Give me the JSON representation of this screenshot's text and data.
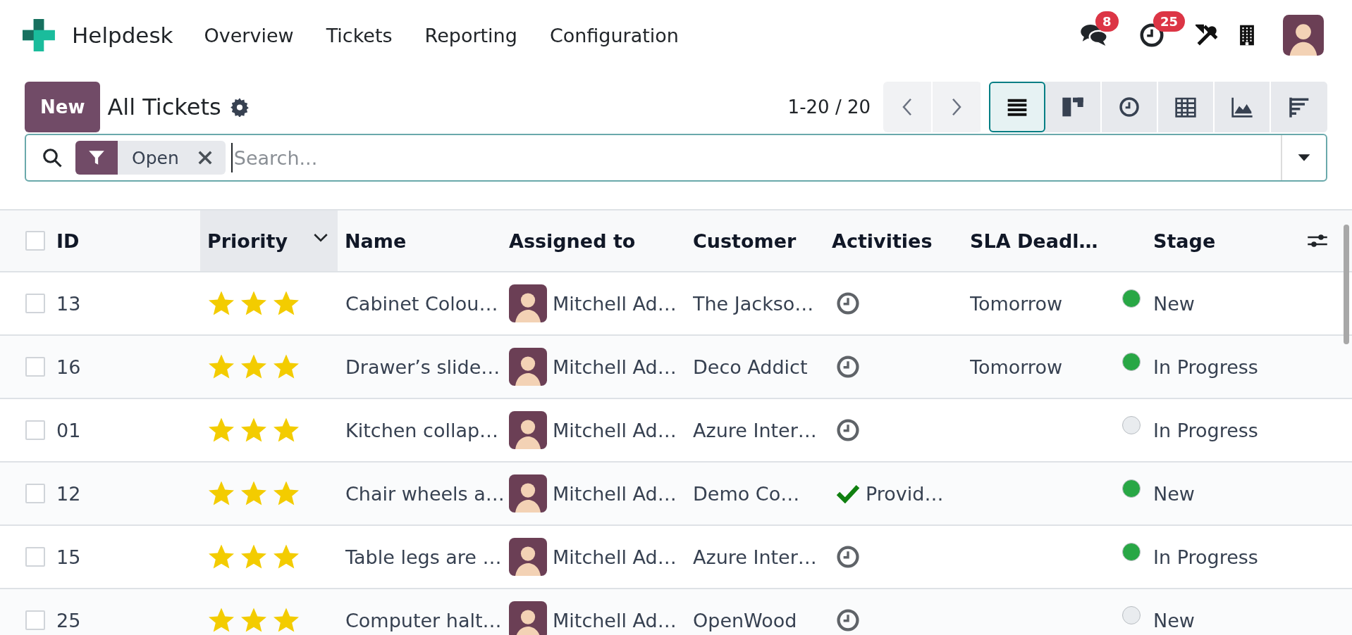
{
  "app": {
    "name": "Helpdesk"
  },
  "menu": [
    "Overview",
    "Tickets",
    "Reporting",
    "Configuration"
  ],
  "systray": {
    "messages_badge": "8",
    "activities_badge": "25"
  },
  "control_panel": {
    "new_button": "New",
    "title": "All Tickets",
    "pager": "1-20 / 20",
    "views": [
      {
        "kind": "list",
        "selected": true
      },
      {
        "kind": "kanban",
        "selected": false
      },
      {
        "kind": "activity",
        "selected": false
      },
      {
        "kind": "pivot",
        "selected": false
      },
      {
        "kind": "graph",
        "selected": false
      },
      {
        "kind": "cohort",
        "selected": false
      }
    ]
  },
  "search": {
    "facet": "Open",
    "placeholder": "Search..."
  },
  "table": {
    "all_checked": false,
    "columns": [
      {
        "label": "ID",
        "sorted": false
      },
      {
        "label": "Priority",
        "sorted": true
      },
      {
        "label": "Name",
        "sorted": false
      },
      {
        "label": "Assigned to",
        "sorted": false
      },
      {
        "label": "Customer",
        "sorted": false
      },
      {
        "label": "Activities",
        "sorted": false
      },
      {
        "label": "SLA Deadl…",
        "sorted": false
      },
      {
        "label": "Stage",
        "sorted": false
      }
    ],
    "rows": [
      {
        "checked": false,
        "id": "13",
        "stars": 3,
        "name": "Cabinet Colou…",
        "assigned": "Mitchell Ad…",
        "customer": "The Jackso…",
        "activity": {
          "kind": "clock"
        },
        "sla": "Tomorrow",
        "color": "#28a745",
        "stage": "New"
      },
      {
        "checked": false,
        "id": "16",
        "stars": 3,
        "name": "Drawer’s slide…",
        "assigned": "Mitchell Ad…",
        "customer": "Deco Addict",
        "activity": {
          "kind": "clock"
        },
        "sla": "Tomorrow",
        "color": "#28a745",
        "stage": "In Progress"
      },
      {
        "checked": false,
        "id": "01",
        "stars": 3,
        "name": "Kitchen collap…",
        "assigned": "Mitchell Ad…",
        "customer": "Azure Inter…",
        "activity": {
          "kind": "clock"
        },
        "color": "#e9ecef",
        "stage": "In Progress"
      },
      {
        "checked": false,
        "id": "12",
        "stars": 3,
        "name": "Chair wheels a…",
        "assigned": "Mitchell Ad…",
        "customer": "Demo Co…",
        "activity": {
          "kind": "done",
          "label": "Provid…"
        },
        "color": "#28a745",
        "stage": "New"
      },
      {
        "checked": false,
        "id": "15",
        "stars": 3,
        "name": "Table legs are …",
        "assigned": "Mitchell Ad…",
        "customer": "Azure Inter…",
        "activity": {
          "kind": "clock"
        },
        "color": "#28a745",
        "stage": "In Progress"
      },
      {
        "checked": false,
        "id": "25",
        "stars": 3,
        "name": "Computer halt…",
        "assigned": "Mitchell Ad…",
        "customer": "OpenWood",
        "activity": {
          "kind": "clock"
        },
        "color": "#e9ecef",
        "stage": "New"
      }
    ]
  }
}
